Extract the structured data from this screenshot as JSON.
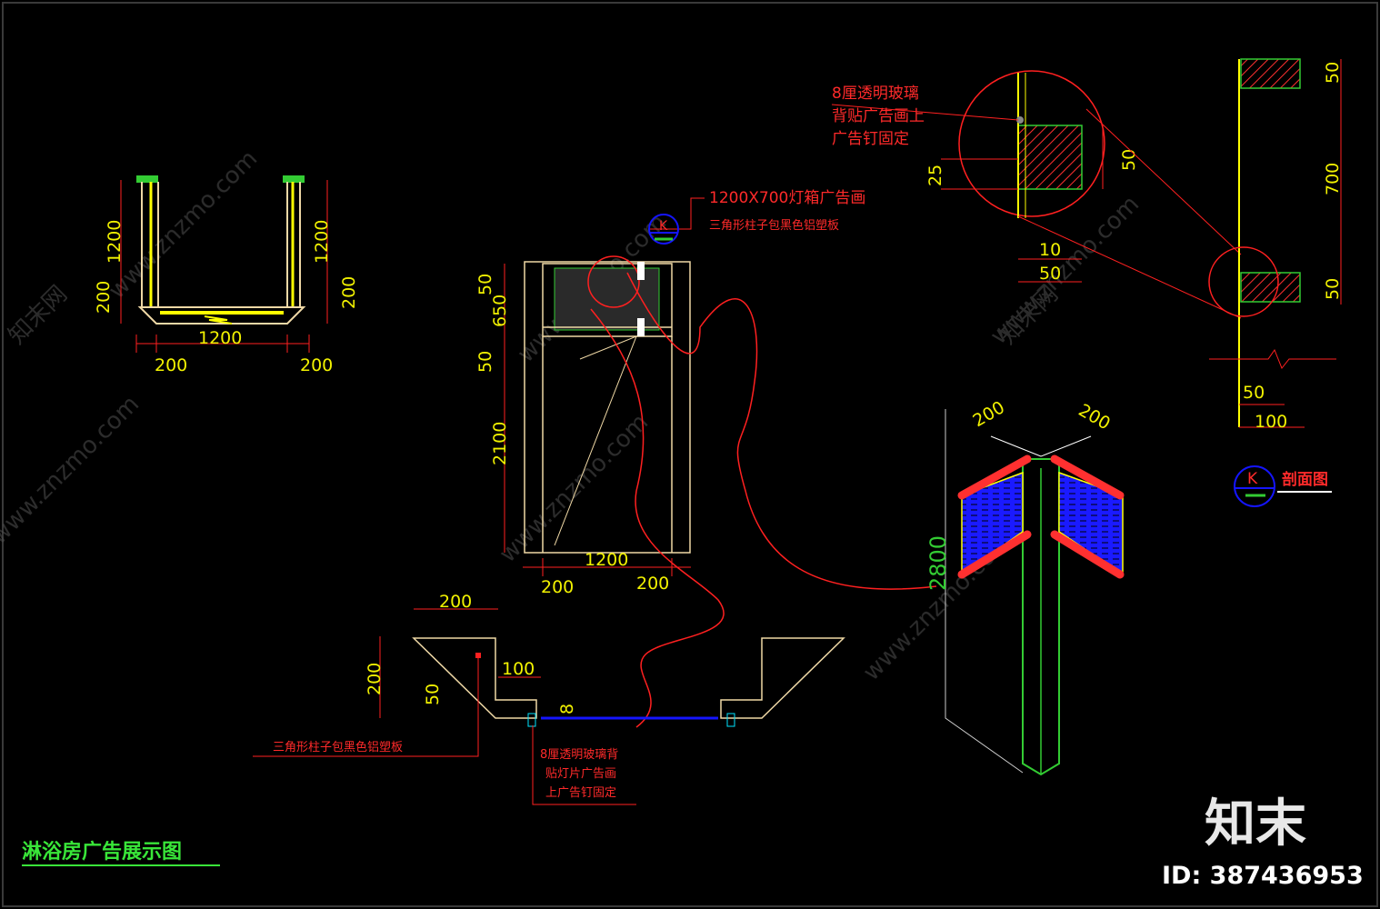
{
  "drawing": {
    "title": "淋浴房广告展示图",
    "section_tag": "K",
    "section_title": "剖面图",
    "plan": {
      "h_left": "1200",
      "h_right": "1200",
      "v_left": "200",
      "v_right": "200",
      "bottom": "1200",
      "bl": "200",
      "br": "200"
    },
    "elevation": {
      "d50a": "50",
      "d650": "650",
      "d50b": "50",
      "d2100": "2100",
      "bottom": "1200",
      "bl": "200",
      "br": "200",
      "note1": "1200X700灯箱广告画",
      "note2": "三角形柱子包黑色铝塑板",
      "tag": "K"
    },
    "detail": {
      "d200a": "200",
      "d200b": "200",
      "d100": "100",
      "d50": "50",
      "d8": "8",
      "note_left": "三角形柱子包黑色铝塑板",
      "note_l1": "8厘透明玻璃背",
      "note_l2": "贴灯片广告画",
      "note_l3": "上广告钉固定"
    },
    "magnify": {
      "note1": "8厘透明玻璃",
      "note2": "背贴广告画上",
      "note3": "广告钉固定",
      "d25": "25",
      "d50v": "50",
      "d10": "10",
      "d50h": "50"
    },
    "section": {
      "d50t": "50",
      "d700": "700",
      "d50b": "50",
      "d50h": "50",
      "d100": "100"
    },
    "perspective": {
      "d200a": "200",
      "d200b": "200",
      "d2800": "2800"
    }
  },
  "watermarks": {
    "brand": "知末",
    "id": "ID: 387436953",
    "site": "www.znzmo.com",
    "site_cn": "知末网"
  },
  "colors": {
    "background": "#000000",
    "red": "#ff2020",
    "yellow": "#ffff00",
    "green": "#33cc33",
    "cyan": "#00e5ff",
    "blue": "#1515ff",
    "tan": "#f0d9a6"
  }
}
